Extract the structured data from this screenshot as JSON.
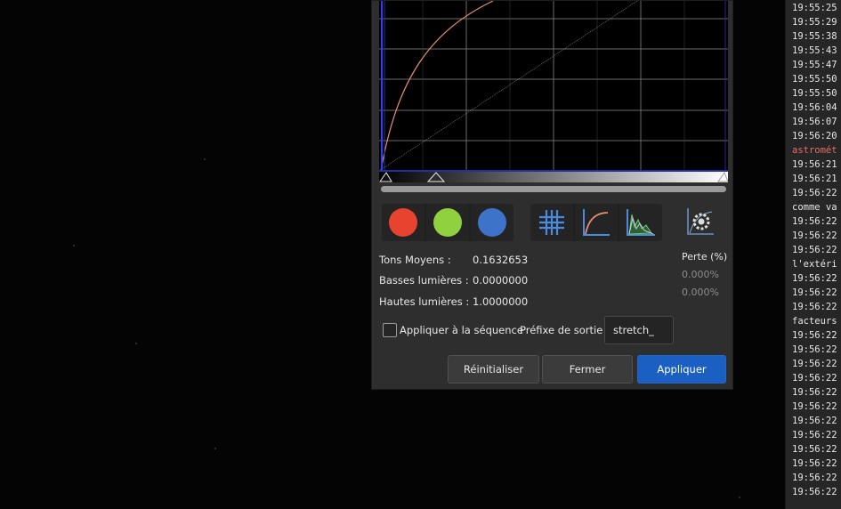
{
  "dialog": {
    "stats": {
      "midtones_label": "Tons Moyens :",
      "midtones_value": "0.1632653",
      "shadows_label": "Basses lumières :",
      "shadows_value": "0.0000000",
      "highlights_label": "Hautes lumières :",
      "highlights_value": "1.0000000"
    },
    "loss": {
      "header": "Perte (%)",
      "shadows": "0.000%",
      "highlights": "0.000%"
    },
    "apply_sequence_label": "Appliquer à la séquence",
    "prefix_label": "Préfixe de sortie :",
    "prefix_value": "stretch_",
    "buttons": {
      "reset": "Réinitialiser",
      "close": "Fermer",
      "apply": "Appliquer"
    },
    "channel_colors": {
      "red": "#e8432e",
      "green": "#8fd13f",
      "blue": "#3d73c9"
    },
    "icons": [
      "red-channel",
      "green-channel",
      "blue-channel",
      "grid-icon",
      "curve-icon",
      "histogram-icon",
      "auto-stretch-icon"
    ]
  },
  "console": {
    "lines": [
      {
        "text": "19:55:25"
      },
      {
        "text": "19:55:29"
      },
      {
        "text": "19:55:38"
      },
      {
        "text": "19:55:43"
      },
      {
        "text": "19:55:47"
      },
      {
        "text": "19:55:50"
      },
      {
        "text": "19:55:50"
      },
      {
        "text": "19:56:04"
      },
      {
        "text": "19:56:07"
      },
      {
        "text": "19:56:20"
      },
      {
        "text": "astromét",
        "color": "#e0706a"
      },
      {
        "text": "19:56:21"
      },
      {
        "text": "19:56:21"
      },
      {
        "text": "19:56:22"
      },
      {
        "text": "comme va"
      },
      {
        "text": "19:56:22"
      },
      {
        "text": "19:56:22"
      },
      {
        "text": "19:56:22"
      },
      {
        "text": "l'extéri"
      },
      {
        "text": "19:56:22"
      },
      {
        "text": "19:56:22"
      },
      {
        "text": "19:56:22"
      },
      {
        "text": "facteurs"
      },
      {
        "text": "19:56:22"
      },
      {
        "text": "19:56:22"
      },
      {
        "text": "19:56:22"
      },
      {
        "text": "19:56:22"
      },
      {
        "text": "19:56:22"
      },
      {
        "text": "19:56:22"
      },
      {
        "text": "19:56:22"
      },
      {
        "text": "19:56:22"
      },
      {
        "text": "19:56:22"
      },
      {
        "text": "19:56:22"
      },
      {
        "text": "19:56:22"
      },
      {
        "text": "19:56:22"
      }
    ]
  }
}
